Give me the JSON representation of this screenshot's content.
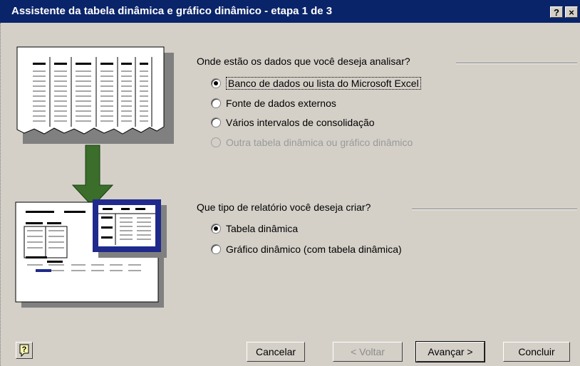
{
  "window": {
    "title": "Assistente da tabela dinâmica e gráfico dinâmico - etapa 1 de 3",
    "help_glyph": "?",
    "close_glyph": "×"
  },
  "source_group": {
    "label": "Onde estão os dados que você deseja analisar?",
    "options": [
      {
        "text": "Banco de dados ou lista do Microsoft Excel",
        "checked": true,
        "enabled": true
      },
      {
        "text": "Fonte de dados externos",
        "checked": false,
        "enabled": true
      },
      {
        "text": "Vários intervalos de consolidação",
        "checked": false,
        "enabled": true
      },
      {
        "text": "Outra tabela dinâmica ou gráfico dinâmico",
        "checked": false,
        "enabled": false
      }
    ]
  },
  "report_group": {
    "label": "Que tipo de relatório você deseja criar?",
    "options": [
      {
        "text": "Tabela dinâmica",
        "checked": true,
        "enabled": true
      },
      {
        "text": "Gráfico dinâmico (com tabela dinâmica)",
        "checked": false,
        "enabled": true
      }
    ]
  },
  "buttons": {
    "cancel": "Cancelar",
    "back": "< Voltar",
    "next": "Avançar >",
    "finish": "Concluir"
  },
  "colors": {
    "titlebar": "#0a246a",
    "arrow": "#3a6e2a",
    "pivot_frame": "#1f2a8c"
  },
  "icons": {
    "help_button": "help-assistant-icon",
    "illustration": "pivot-wizard-illustration"
  }
}
